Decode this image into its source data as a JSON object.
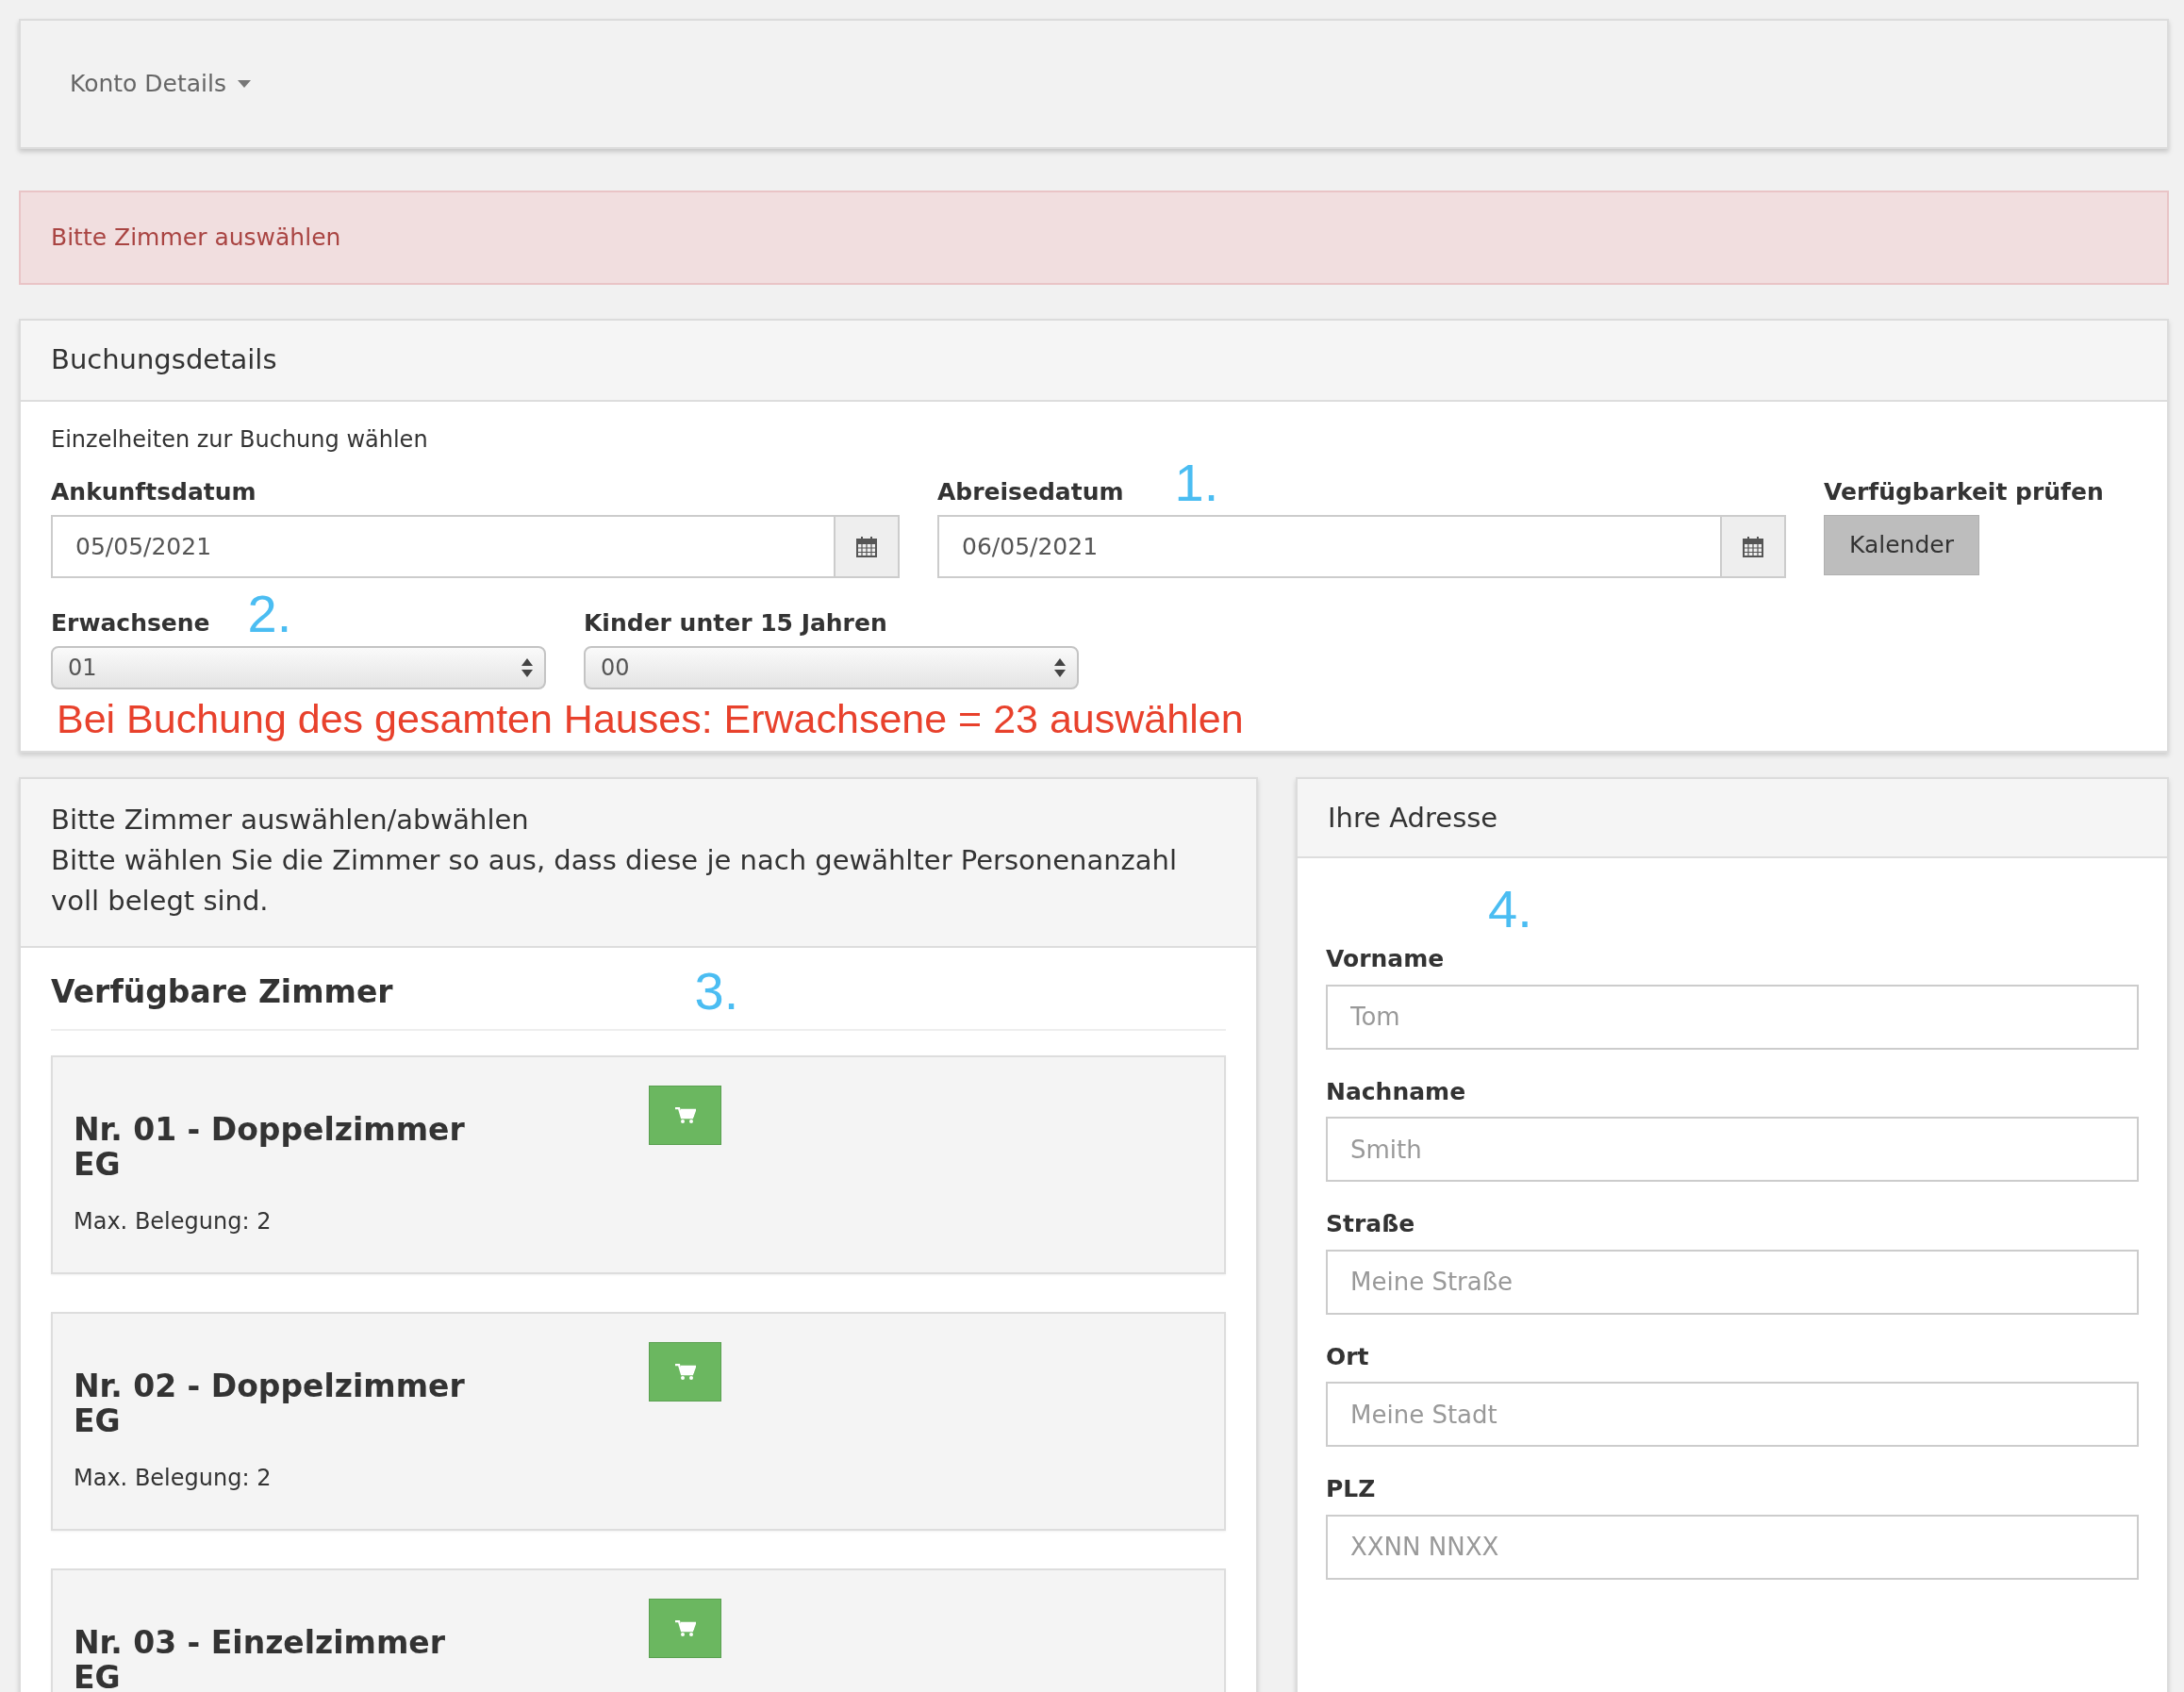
{
  "navbar": {
    "menu_label": "Konto Details"
  },
  "alert": {
    "text": "Bitte Zimmer auswählen"
  },
  "booking": {
    "title": "Buchungsdetails",
    "subtitle": "Einzelheiten zur Buchung wählen",
    "arrival": {
      "label": "Ankunftsdatum",
      "value": "05/05/2021"
    },
    "departure": {
      "label": "Abreisedatum",
      "value": "06/05/2021",
      "annotation": "1."
    },
    "availability": {
      "label": "Verfügbarkeit prüfen",
      "button": "Kalender"
    },
    "adults": {
      "label": "Erwachsene",
      "value": "01",
      "annotation": "2."
    },
    "children": {
      "label": "Kinder unter 15 Jahren",
      "value": "00"
    },
    "note": "Bei Buchung des gesamten Hauses: Erwachsene = 23 auswählen"
  },
  "rooms_panel": {
    "header_title": "Bitte Zimmer auswählen/abwählen",
    "header_text": "Bitte wählen Sie die Zimmer so aus, dass diese je nach gewählter Personenanzahl voll belegt sind.",
    "heading": "Verfügbare Zimmer",
    "annotation": "3.",
    "rooms": [
      {
        "title": "Nr. 01 - Doppelzimmer",
        "floor": "EG",
        "capacity": "Max. Belegung: 2"
      },
      {
        "title": "Nr. 02 - Doppelzimmer",
        "floor": "EG",
        "capacity": "Max. Belegung: 2"
      },
      {
        "title": "Nr. 03 - Einzelzimmer",
        "floor": "EG"
      }
    ]
  },
  "address": {
    "title": "Ihre Adresse",
    "annotation": "4.",
    "fields": [
      {
        "label": "Vorname",
        "placeholder": "Tom"
      },
      {
        "label": "Nachname",
        "placeholder": "Smith"
      },
      {
        "label": "Straße",
        "placeholder": "Meine Straße"
      },
      {
        "label": "Ort",
        "placeholder": "Meine Stadt"
      },
      {
        "label": "PLZ",
        "placeholder": "XXNN NNXX"
      }
    ]
  }
}
